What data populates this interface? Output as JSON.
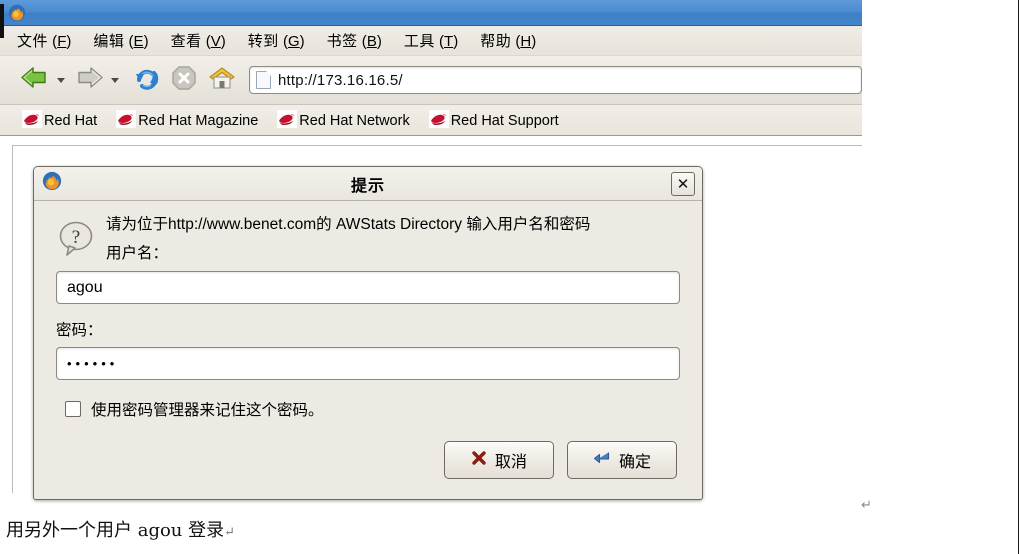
{
  "window": {
    "title_bar_icon": "firefox-icon",
    "titlebar_color": "#4a8bd0"
  },
  "menubar": {
    "items": [
      {
        "name": "file",
        "label": "文件",
        "accel": "F"
      },
      {
        "name": "edit",
        "label": "编辑",
        "accel": "E"
      },
      {
        "name": "view",
        "label": "查看",
        "accel": "V"
      },
      {
        "name": "go",
        "label": "转到",
        "accel": "G"
      },
      {
        "name": "bookmarks",
        "label": "书签",
        "accel": "B"
      },
      {
        "name": "tools",
        "label": "工具",
        "accel": "T"
      },
      {
        "name": "help",
        "label": "帮助",
        "accel": "H"
      }
    ]
  },
  "toolbar": {
    "back_icon": "back-arrow-icon",
    "forward_icon": "forward-arrow-icon",
    "reload_icon": "reload-icon",
    "stop_icon": "stop-icon",
    "home_icon": "home-icon",
    "url_value": "http://173.16.16.5/",
    "url_placeholder": "",
    "page_icon": "page-document-icon"
  },
  "bookmarks": {
    "items": [
      {
        "label": "Red Hat",
        "icon": "redhat-fedora-icon"
      },
      {
        "label": "Red Hat Magazine",
        "icon": "redhat-fedora-icon"
      },
      {
        "label": "Red Hat Network",
        "icon": "redhat-fedora-icon"
      },
      {
        "label": "Red Hat Support",
        "icon": "redhat-fedora-icon"
      }
    ]
  },
  "dialog": {
    "title": "提示",
    "title_icon": "firefox-icon",
    "close_label": "✕",
    "prompt_icon": "question-bubble-icon",
    "message": "请为位于http://www.benet.com的 AWStats Directory 输入用户名和密码",
    "username_label": "用户名：",
    "username_value": "agou",
    "password_label": "密码：",
    "password_value": "••••••",
    "remember_label": "使用密码管理器来记住这个密码。",
    "remember_checked": false,
    "cancel_label": "取消",
    "cancel_icon": "x-mark-icon",
    "ok_label": "确定",
    "ok_icon": "enter-arrow-icon"
  },
  "caption": {
    "text": "用另外一个用户 agou 登录",
    "return_mark": "↵"
  },
  "stray_mark": {
    "text": "↵"
  }
}
